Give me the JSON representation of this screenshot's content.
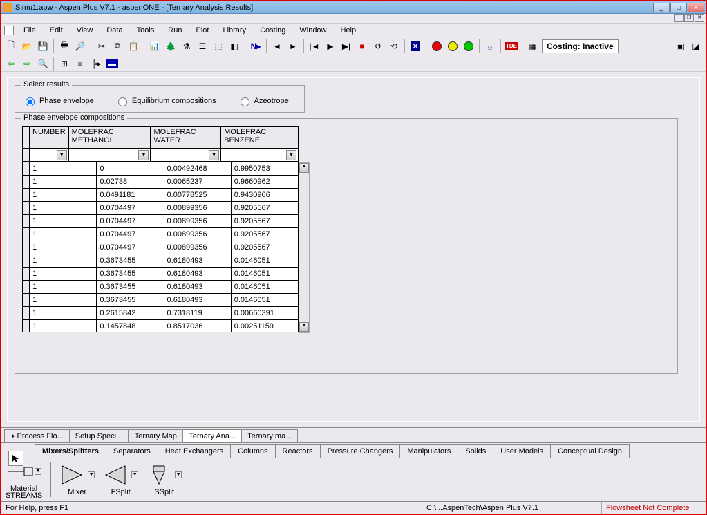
{
  "title": "Simu1.apw - Aspen Plus V7.1 - aspenONE - [Ternary Analysis Results]",
  "menu": [
    "File",
    "Edit",
    "View",
    "Data",
    "Tools",
    "Run",
    "Plot",
    "Library",
    "Costing",
    "Window",
    "Help"
  ],
  "costing_label": "Costing: Inactive",
  "select_group": {
    "title": "Select results",
    "options": [
      "Phase envelope",
      "Equilibrium compositions",
      "Azeotrope"
    ],
    "selected": 0
  },
  "comp_group_title": "Phase envelope compositions",
  "columns": [
    "NUMBER",
    "MOLEFRAC METHANOL",
    "MOLEFRAC WATER",
    "MOLEFRAC BENZENE"
  ],
  "rows": [
    [
      "1",
      "0",
      "0.00492468",
      "0.9950753"
    ],
    [
      "1",
      "0.02738",
      "0.0065237",
      "0.9660962"
    ],
    [
      "1",
      "0.0491181",
      "0.00778525",
      "0.9430966"
    ],
    [
      "1",
      "0.0704497",
      "0.00899356",
      "0.9205567"
    ],
    [
      "1",
      "0.0704497",
      "0.00899356",
      "0.9205567"
    ],
    [
      "1",
      "0.0704497",
      "0.00899356",
      "0.9205567"
    ],
    [
      "1",
      "0.0704497",
      "0.00899356",
      "0.9205567"
    ],
    [
      "1",
      "0.3673455",
      "0.6180493",
      "0.0146051"
    ],
    [
      "1",
      "0.3673455",
      "0.6180493",
      "0.0146051"
    ],
    [
      "1",
      "0.3673455",
      "0.6180493",
      "0.0146051"
    ],
    [
      "1",
      "0.3673455",
      "0.6180493",
      "0.0146051"
    ],
    [
      "1",
      "0.2615842",
      "0.7318119",
      "0.00660391"
    ],
    [
      "1",
      "0.1457848",
      "0.8517036",
      "0.00251159"
    ]
  ],
  "doc_tabs": [
    "Process Flo...",
    "Setup Speci...",
    "Ternary Map ",
    "Ternary Ana...",
    "Ternary ma..."
  ],
  "doc_tab_active": 3,
  "palette_tabs": [
    "Mixers/Splitters",
    "Separators",
    "Heat Exchangers",
    "Columns",
    "Reactors",
    "Pressure Changers",
    "Manipulators",
    "Solids",
    "User Models",
    "Conceptual Design"
  ],
  "palette_active": 0,
  "material_label_top": "Material",
  "material_label_bot": "STREAMS",
  "models": [
    "Mixer",
    "FSplit",
    "SSplit"
  ],
  "status": {
    "help": "For Help, press F1",
    "path": "C:\\...AspenTech\\Aspen Plus V7.1",
    "flowsheet": "Flowsheet Not Complete"
  }
}
